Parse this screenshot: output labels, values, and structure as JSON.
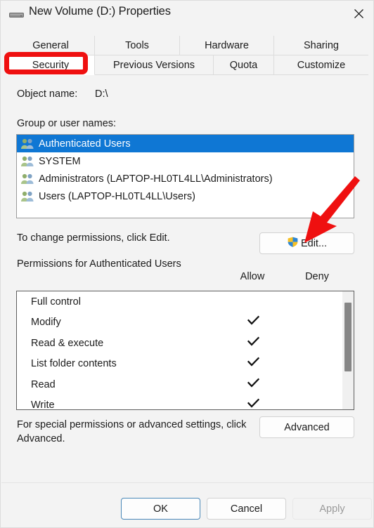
{
  "window": {
    "title": "New Volume (D:) Properties",
    "icon": "drive-icon",
    "close_label": "✕"
  },
  "tabs": {
    "row1": [
      {
        "label": "General",
        "selected": false
      },
      {
        "label": "Tools",
        "selected": false
      },
      {
        "label": "Hardware",
        "selected": false
      },
      {
        "label": "Sharing",
        "selected": false
      }
    ],
    "row2": [
      {
        "label": "Security",
        "selected": true
      },
      {
        "label": "Previous Versions",
        "selected": false
      },
      {
        "label": "Quota",
        "selected": false
      },
      {
        "label": "Customize",
        "selected": false
      }
    ]
  },
  "security": {
    "object_name_label": "Object name:",
    "object_name_value": "D:\\",
    "group_label": "Group or user names:",
    "groups": [
      {
        "name": "Authenticated Users",
        "selected": true
      },
      {
        "name": "SYSTEM",
        "selected": false
      },
      {
        "name": "Administrators (LAPTOP-HL0TL4LL\\Administrators)",
        "selected": false
      },
      {
        "name": "Users (LAPTOP-HL0TL4LL\\Users)",
        "selected": false
      }
    ],
    "change_permissions_text": "To change permissions, click Edit.",
    "edit_button": "Edit...",
    "permissions_title": "Permissions for Authenticated Users",
    "allow_header": "Allow",
    "deny_header": "Deny",
    "permissions": [
      {
        "name": "Full control",
        "allow": false,
        "deny": false
      },
      {
        "name": "Modify",
        "allow": true,
        "deny": false
      },
      {
        "name": "Read & execute",
        "allow": true,
        "deny": false
      },
      {
        "name": "List folder contents",
        "allow": true,
        "deny": false
      },
      {
        "name": "Read",
        "allow": true,
        "deny": false
      },
      {
        "name": "Write",
        "allow": true,
        "deny": false
      }
    ],
    "advanced_text": "For special permissions or advanced settings, click Advanced.",
    "advanced_button": "Advanced"
  },
  "footer": {
    "ok": "OK",
    "cancel": "Cancel",
    "apply": "Apply"
  },
  "annotations": {
    "highlight_color": "#ef1010",
    "arrow_color": "#ef1010",
    "highlight_target": "Security",
    "arrow_target": "Edit..."
  },
  "colors": {
    "dialog_background": "#f3f3f3",
    "selection_blue": "#0f77d4",
    "text": "#1b1b1b",
    "disabled_text": "#9a9a9a",
    "scrollbar_thumb": "#868686"
  }
}
